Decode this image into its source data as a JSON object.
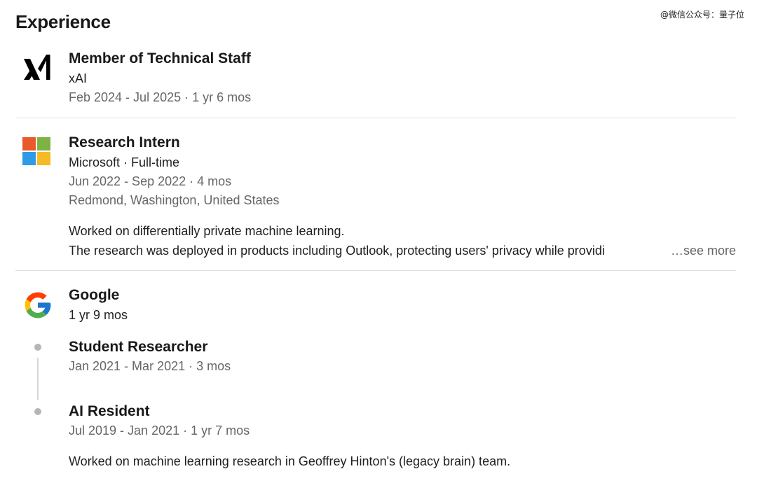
{
  "watermark": "@微信公众号：量子位",
  "section_title": "Experience",
  "entries": [
    {
      "logo": "xai-logo",
      "title": "Member of Technical Staff",
      "company": "xAI",
      "dates": "Feb 2024 - Jul 2025 · 1 yr 6 mos"
    },
    {
      "logo": "microsoft-logo",
      "title": "Research Intern",
      "company": "Microsoft · Full-time",
      "dates": "Jun 2022 - Sep 2022 · 4 mos",
      "location": "Redmond, Washington, United States",
      "desc_line1": "Worked on differentially private machine learning.",
      "desc_line2": "The research was deployed in products including Outlook, protecting users' privacy while providi",
      "see_more": "…see more"
    }
  ],
  "google": {
    "logo": "google-logo",
    "company": "Google",
    "total_duration": "1 yr 9 mos",
    "roles": [
      {
        "title": "Student Researcher",
        "dates": "Jan 2021 - Mar 2021 · 3 mos"
      },
      {
        "title": "AI Resident",
        "dates": "Jul 2019 - Jan 2021 · 1 yr 7 mos",
        "desc": "Worked on machine learning research in Geoffrey Hinton's (legacy brain) team."
      }
    ]
  },
  "colors": {
    "ms_red": "#f25022",
    "ms_green": "#7fba00",
    "ms_blue": "#00a4ef",
    "ms_yellow": "#ffb900",
    "meta_gray": "#666666"
  }
}
